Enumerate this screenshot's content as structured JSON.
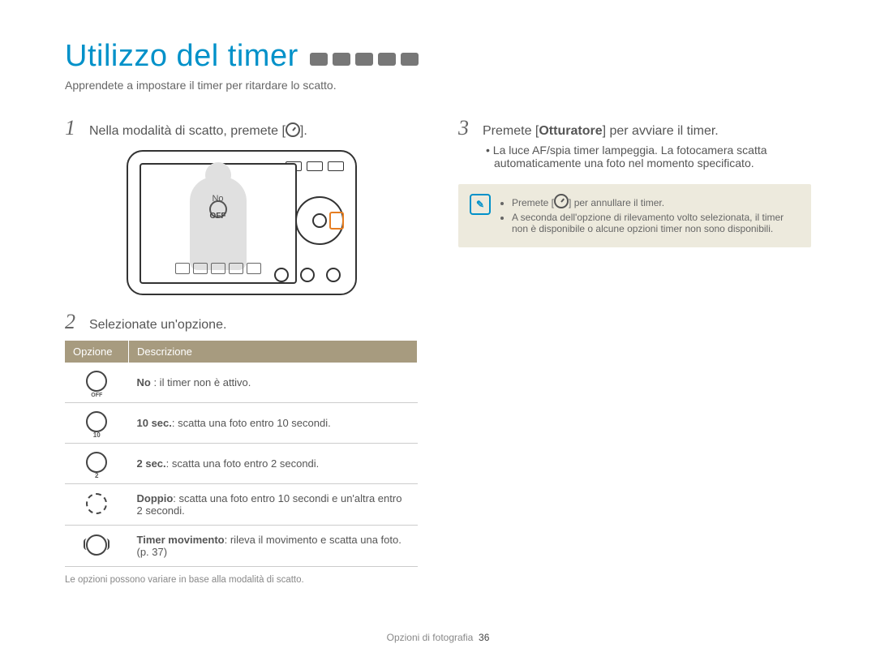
{
  "title": "Utilizzo del timer",
  "subtitle": "Apprendete a impostare il timer per ritardare lo scatto.",
  "steps": {
    "s1": {
      "num": "1",
      "prefix": "Nella modalità di scatto, premete [",
      "suffix": "]."
    },
    "s2": {
      "num": "2",
      "text": "Selezionate un'opzione."
    },
    "s3": {
      "num": "3",
      "prefix": "Premete [",
      "bold": "Otturatore",
      "suffix": "] per avviare il timer."
    }
  },
  "camera_screen": {
    "label": "No",
    "off": "OFF"
  },
  "table": {
    "h1": "Opzione",
    "h2": "Descrizione",
    "rows": [
      {
        "bold": "No",
        "rest": " : il timer non è attivo."
      },
      {
        "bold": "10 sec.",
        "rest": ": scatta una foto entro 10 secondi."
      },
      {
        "bold": "2 sec.",
        "rest": ": scatta una foto entro 2 secondi."
      },
      {
        "bold": "Doppio",
        "rest": ": scatta una foto entro 10 secondi e un'altra entro 2 secondi."
      },
      {
        "bold": "Timer movimento",
        "rest": ": rileva il movimento e scatta una foto. (p. 37)"
      }
    ]
  },
  "table_note": "Le opzioni possono variare in base alla modalità di scatto.",
  "step3_bullet": "La luce AF/spia timer lampeggia. La fotocamera scatta automaticamente una foto nel momento specificato.",
  "info": {
    "b1_prefix": "Premete [",
    "b1_suffix": "] per annullare il timer.",
    "b2": "A seconda dell'opzione di rilevamento volto selezionata, il timer non è disponibile o alcune opzioni timer non sono disponibili."
  },
  "footer": {
    "section": "Opzioni di fotografia",
    "page": "36"
  }
}
